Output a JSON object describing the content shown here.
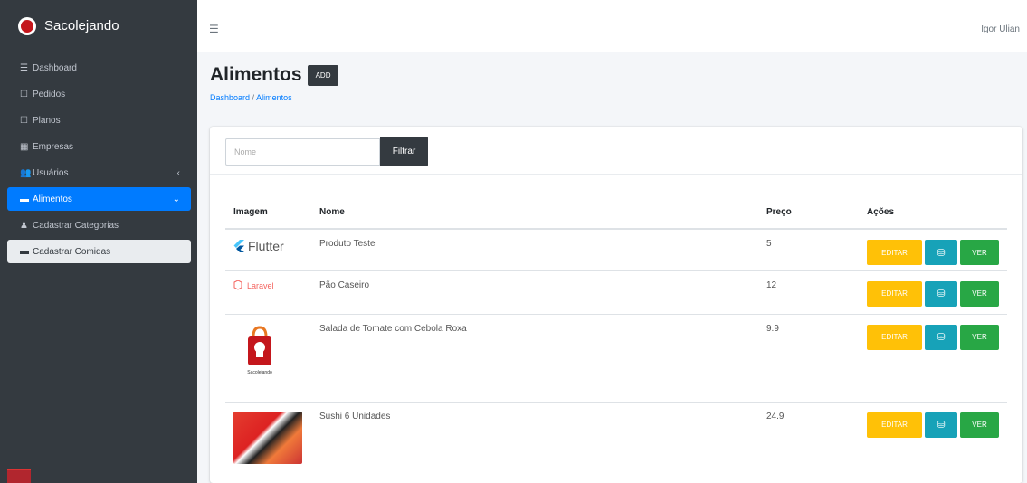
{
  "app": {
    "brand": "Sacolejando"
  },
  "sidebar": {
    "items": [
      {
        "label": "Dashboard",
        "icon": "dashboard-icon"
      },
      {
        "label": "Pedidos",
        "icon": "calendar-icon"
      },
      {
        "label": "Planos",
        "icon": "calendar-icon"
      },
      {
        "label": "Empresas",
        "icon": "building-icon"
      },
      {
        "label": "Usuários",
        "icon": "users-icon"
      },
      {
        "label": "Alimentos",
        "icon": "food-icon"
      },
      {
        "label": "Cadastrar Categorias",
        "icon": "user-icon"
      },
      {
        "label": "Cadastrar Comidas",
        "icon": "food-icon"
      }
    ]
  },
  "topbar": {
    "user": "Igor Ulian"
  },
  "header": {
    "title": "Alimentos",
    "add_label": "ADD",
    "breadcrumb": [
      "Dashboard",
      "Alimentos"
    ],
    "breadcrumb_sep": "/"
  },
  "filter": {
    "placeholder": "Nome",
    "button": "Filtrar"
  },
  "table": {
    "columns": [
      "Imagem",
      "Nome",
      "Preço",
      "Ações"
    ],
    "rows": [
      {
        "image": "Flutter",
        "nome": "Produto Teste",
        "preco": "5"
      },
      {
        "image": "Laravel",
        "nome": "Pão Caseiro",
        "preco": "12"
      },
      {
        "image": "Sacolejando",
        "nome": "Salada de Tomate com Cebola Roxa",
        "preco": "9.9"
      },
      {
        "image": "sushi-photo",
        "nome": "Sushi 6 Unidades",
        "preco": "24.9"
      }
    ],
    "actions": {
      "edit": "EDITAR",
      "ver": "VER"
    }
  },
  "colors": {
    "sidebar": "#343a40",
    "active": "#007bff",
    "edit": "#ffc107",
    "info": "#17a2b8",
    "success": "#28a745"
  }
}
